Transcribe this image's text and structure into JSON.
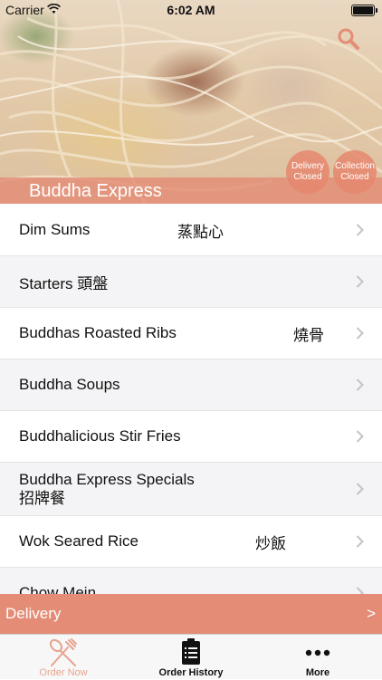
{
  "status_bar": {
    "carrier": "Carrier",
    "time": "6:02 AM"
  },
  "header": {
    "restaurant_name": "Buddha Express",
    "delivery_status": [
      "Delivery",
      "Closed"
    ],
    "collection_status": [
      "Collection",
      "Closed"
    ]
  },
  "menu": {
    "items": [
      {
        "name": "Dim Sums",
        "name_cn": "蒸點心"
      },
      {
        "name": "Starters  頭盤",
        "name_cn": ""
      },
      {
        "name": "Buddhas Roasted Ribs",
        "name_cn": "燒骨"
      },
      {
        "name": "Buddha Soups",
        "name_cn": ""
      },
      {
        "name": "Buddhalicious Stir Fries",
        "name_cn": ""
      },
      {
        "name": "Buddha Express Specials",
        "name_cn": "招牌餐"
      },
      {
        "name": "Wok Seared Rice",
        "name_cn": "炒飯"
      },
      {
        "name": "Chow Mein",
        "name_cn": ""
      }
    ]
  },
  "delivery_bar": {
    "label": "Delivery",
    "arrow": ">"
  },
  "tabs": [
    {
      "label": "Order Now",
      "icon": "fork-spoon-icon"
    },
    {
      "label": "Order History",
      "icon": "clipboard-icon"
    },
    {
      "label": "More",
      "icon": "more-dots-icon"
    }
  ],
  "colors": {
    "accent": "#e48c76",
    "tab_active": "#e8a38f"
  }
}
